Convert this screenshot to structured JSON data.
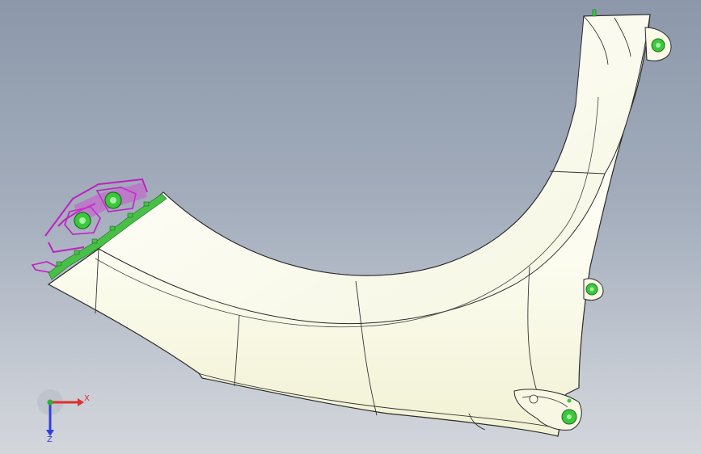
{
  "viewer": {
    "background_top": "#8c98aa",
    "background_bottom": "#d3d6db"
  },
  "model": {
    "body_color": "#fbfbe8",
    "edge_color": "#2a2a2a",
    "bracket_color": "#c020c0",
    "pin_color": "#3cc83c"
  },
  "triad": {
    "x_label": "X",
    "z_label": "Z",
    "x_color": "#e03030",
    "y_color": "#30b030",
    "z_color": "#3040e0"
  }
}
